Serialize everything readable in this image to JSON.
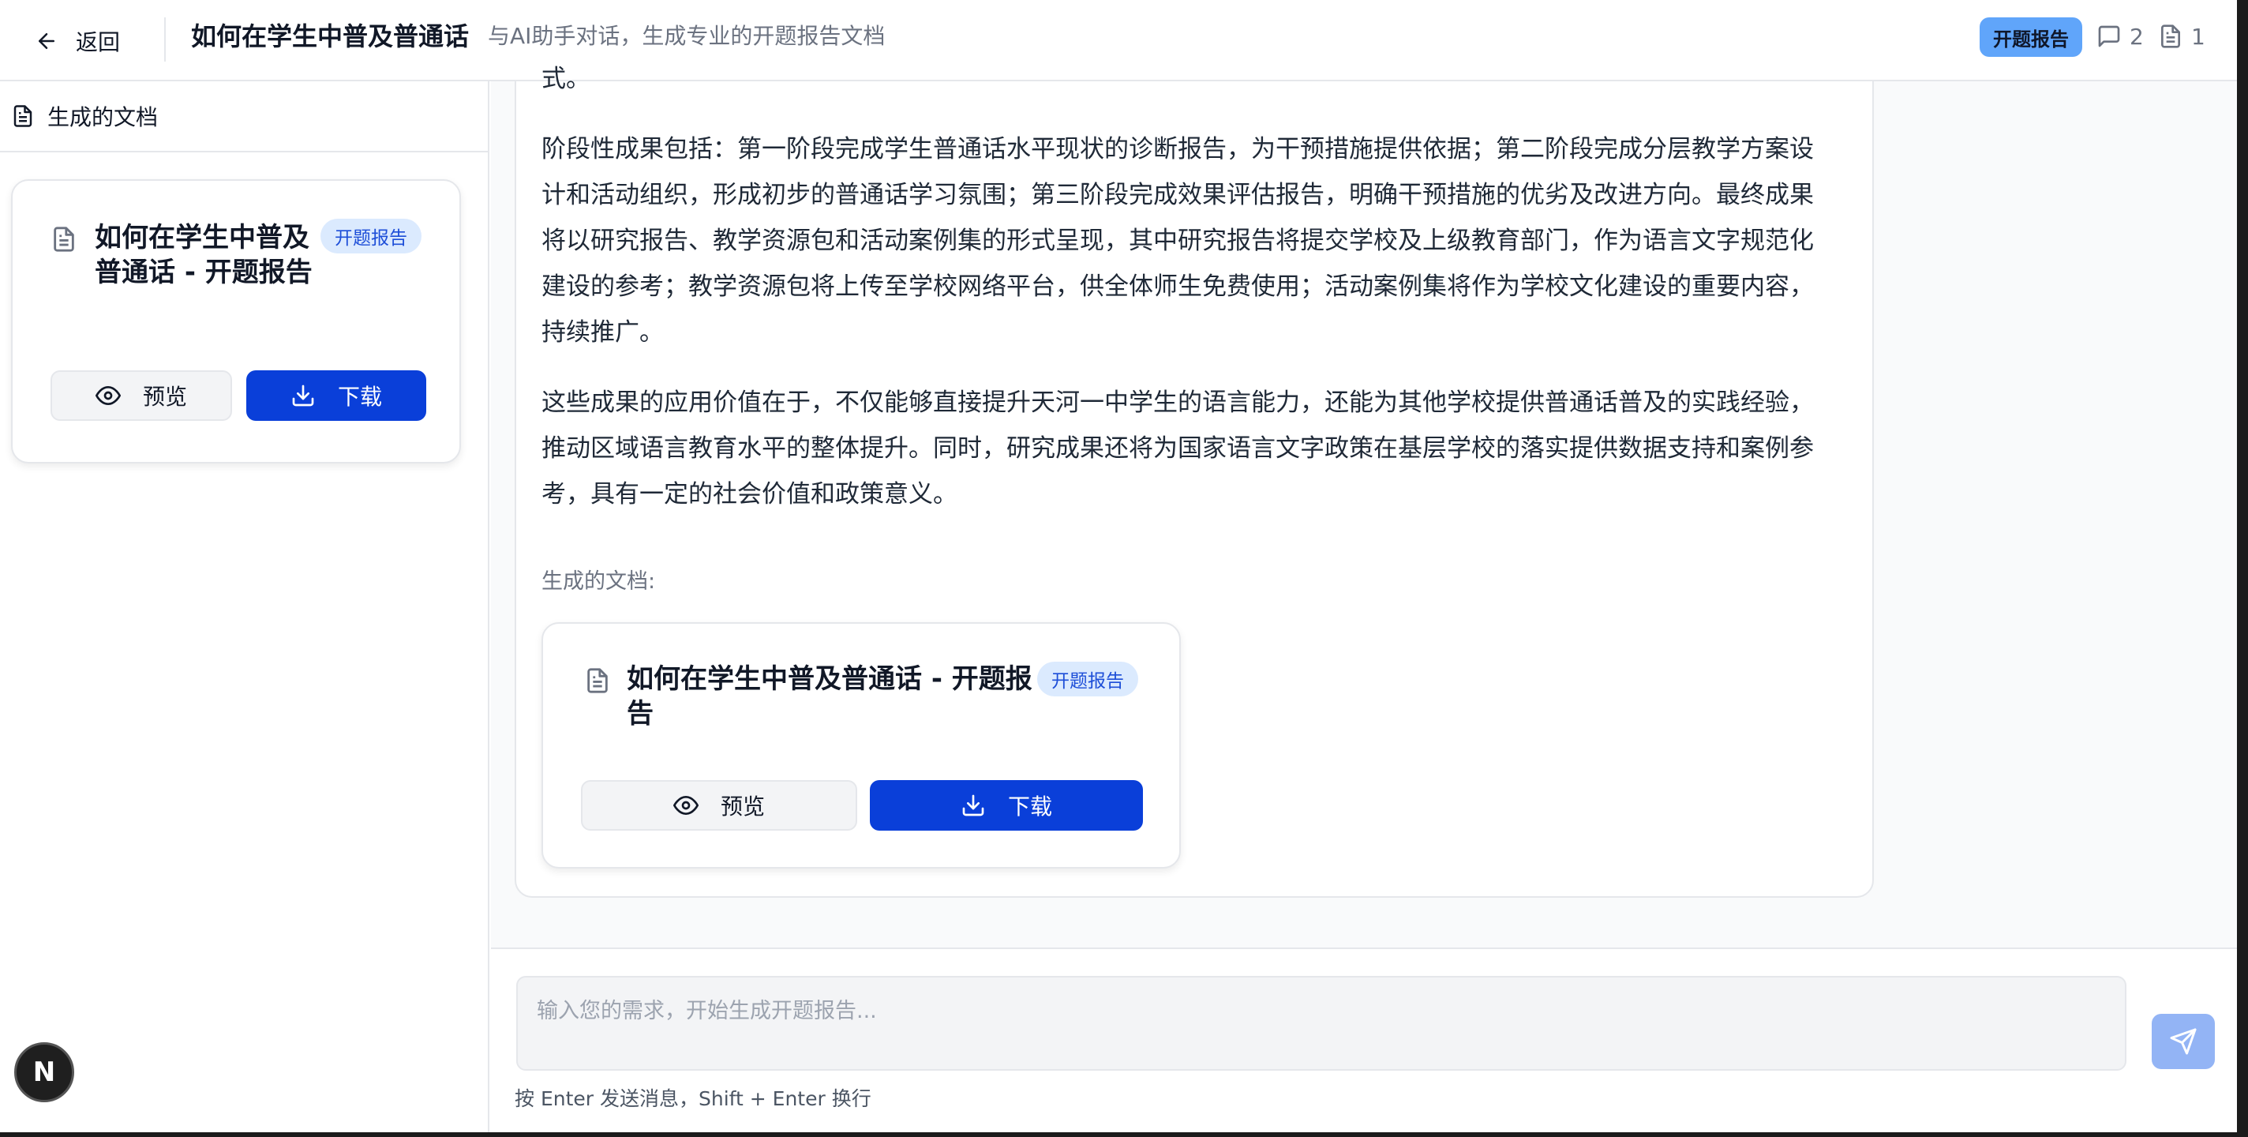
{
  "header": {
    "back_label": "返回",
    "title": "如何在学生中普及普通话",
    "subtitle": "与AI助手对话，生成专业的开题报告文档",
    "type_badge": "开题报告",
    "message_count": "2",
    "document_count": "1"
  },
  "sidebar": {
    "heading": "生成的文档",
    "document": {
      "title": "如何在学生中普及普通话 - 开题报告",
      "badge": "开题报告",
      "preview_label": "预览",
      "download_label": "下载"
    }
  },
  "chat": {
    "partial_line": "式。",
    "paragraphs": [
      "阶段性成果包括：第一阶段完成学生普通话水平现状的诊断报告，为干预措施提供依据；第二阶段完成分层教学方案设计和活动组织，形成初步的普通话学习氛围；第三阶段完成效果评估报告，明确干预措施的优劣及改进方向。最终成果将以研究报告、教学资源包和活动案例集的形式呈现，其中研究报告将提交学校及上级教育部门，作为语言文字规范化建设的参考；教学资源包将上传至学校网络平台，供全体师生免费使用；活动案例集将作为学校文化建设的重要内容，持续推广。",
      "这些成果的应用价值在于，不仅能够直接提升天河一中学生的语言能力，还能为其他学校提供普通话普及的实践经验，推动区域语言教育水平的整体提升。同时，研究成果还将为国家语言文字政策在基层学校的落实提供数据支持和案例参考，具有一定的社会价值和政策意义。"
    ],
    "generated_label": "生成的文档:",
    "document": {
      "title": "如何在学生中普及普通话 - 开题报告",
      "badge": "开题报告",
      "preview_label": "预览",
      "download_label": "下载"
    }
  },
  "input": {
    "placeholder": "输入您的需求，开始生成开题报告...",
    "hint": "按 Enter 发送消息，Shift + Enter 换行"
  },
  "next_badge": "N",
  "colors": {
    "accent": "#0a3fd9",
    "badge_bg": "#dbeafe",
    "badge_text": "#1d4ed8",
    "type_badge_bg": "#60a5fa",
    "send_button": "#93b4f5"
  }
}
